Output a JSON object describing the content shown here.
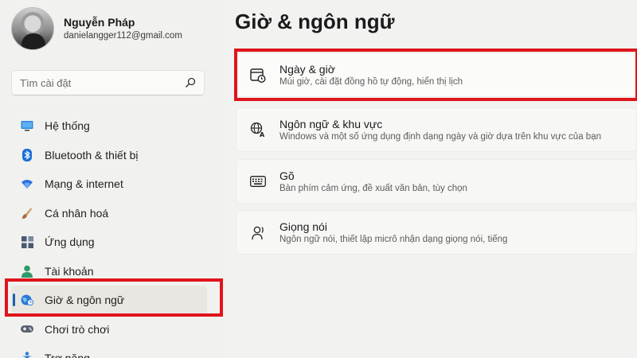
{
  "profile": {
    "name": "Nguyễn Pháp",
    "email": "danielangger112@gmail.com"
  },
  "search": {
    "placeholder": "Tìm cài đặt",
    "icon": "search-icon"
  },
  "nav": {
    "items": [
      {
        "label": "Hệ thống",
        "icon": "monitor-icon",
        "color": "#2b7bd6"
      },
      {
        "label": "Bluetooth & thiết bị",
        "icon": "bluetooth-icon",
        "color": "#1a6fd8"
      },
      {
        "label": "Mạng & internet",
        "icon": "wifi-icon",
        "color": "#2a6fdc"
      },
      {
        "label": "Cá nhân hoá",
        "icon": "brush-icon",
        "color": "#b0673a"
      },
      {
        "label": "Ứng dụng",
        "icon": "apps-icon",
        "color": "#4a5a70"
      },
      {
        "label": "Tài khoản",
        "icon": "person-icon",
        "color": "#2f9a6a"
      },
      {
        "label": "Giờ & ngôn ngữ",
        "icon": "globe-clock-icon",
        "color": "#2a7bd6",
        "active": true
      },
      {
        "label": "Chơi trò chơi",
        "icon": "gamepad-icon",
        "color": "#5b6472"
      },
      {
        "label": "Trợ năng",
        "icon": "accessibility-icon",
        "color": "#2a7bd6"
      }
    ]
  },
  "main": {
    "title": "Giờ & ngôn ngữ",
    "cards": [
      {
        "title": "Ngày & giờ",
        "desc": "Múi giờ, cài đặt đồng hồ tự động, hiển thị lịch",
        "icon": "calendar-clock-icon"
      },
      {
        "title": "Ngôn ngữ & khu vực",
        "desc": "Windows và một số ứng dụng định dạng ngày và giờ dựa trên khu vực của bạn",
        "icon": "language-globe-icon"
      },
      {
        "title": "Gõ",
        "desc": "Bàn phím cảm ứng, đề xuất văn bản, tùy chọn",
        "icon": "keyboard-icon"
      },
      {
        "title": "Giọng nói",
        "desc": "Ngôn ngữ nói, thiết lập micrô nhận dạng giọng nói, tiếng",
        "icon": "speech-icon"
      }
    ]
  },
  "colors": {
    "highlight": "#e0141b",
    "accent": "#1a5fb4"
  }
}
